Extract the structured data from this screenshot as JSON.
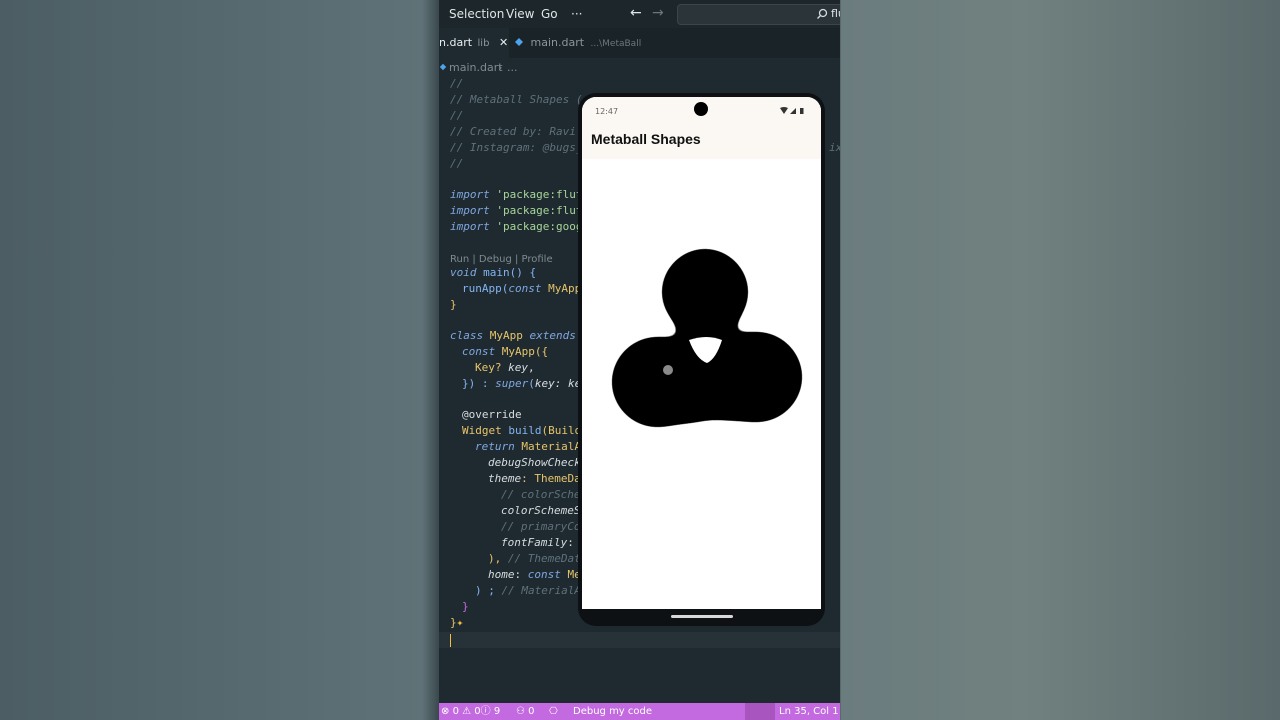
{
  "menubar": {
    "items": [
      "Selection",
      "View",
      "Go"
    ],
    "more": "···",
    "search_value": "flu"
  },
  "tabs": [
    {
      "name": "n.dart",
      "suffix": "lib"
    },
    {
      "name": "main.dart",
      "suffix": "...\\MetaBall"
    }
  ],
  "breadcrumb": {
    "file": "main.dart",
    "rest": "..."
  },
  "code": {
    "c1": "//",
    "c2": "// Metaball Shapes (",
    "c3": "//",
    "c4": "// Created by: Ravi",
    "c5": "// Instagram: @bugs_",
    "c6": "//",
    "imports": [
      "'package:flut",
      "'package:flut",
      "'package:goog"
    ],
    "import_kw": "import",
    "lens": "Run | Debug | Profile",
    "main": [
      "void",
      " main() {"
    ],
    "runapp": [
      "runApp(",
      "const",
      " MyApp"
    ],
    "close1": "}",
    "cls": [
      "class",
      " MyApp ",
      "extends"
    ],
    "ctor": [
      "const",
      " MyApp({"
    ],
    "key": [
      "Key? ",
      "key",
      ","
    ],
    "super": [
      "}) : ",
      "super",
      "(",
      "key",
      ": ke"
    ],
    "override": "@override",
    "build": [
      "Widget ",
      "build",
      "(Build"
    ],
    "ret": [
      "return",
      " MaterialA"
    ],
    "debug": "debugShowCheck",
    "theme": [
      "theme",
      ": ThemeDa"
    ],
    "cm1": "// colorSche",
    "scheme": "colorSchemeS",
    "cm2": "// primaryCo",
    "font": [
      "fontFamily",
      ":"
    ],
    "themeclose": [
      "), ",
      "// ThemeDat"
    ],
    "home": [
      "home",
      ": ",
      "const",
      " Me"
    ],
    "matclose": [
      ") ; ",
      "// MaterialAp"
    ],
    "brace1": "}",
    "brace2": "}",
    "side_label": "ix"
  },
  "status": {
    "errors": "0",
    "warnings": "0",
    "infos": "9",
    "ports": "0",
    "debug": "Debug my code",
    "position": "Ln 35, Col 1"
  },
  "phone": {
    "time": "12:47",
    "app_title": "Metaball Shapes"
  }
}
